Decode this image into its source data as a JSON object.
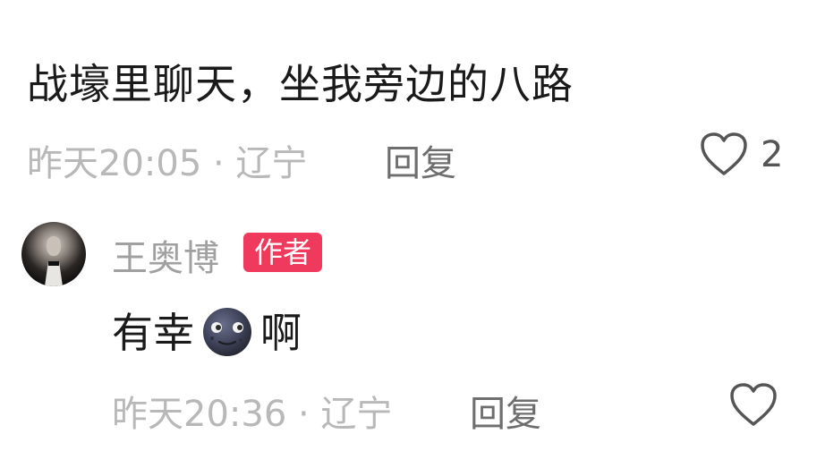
{
  "comment": {
    "text": "战壕里聊天，坐我旁边的八路",
    "meta": "昨天20:05 · 辽宁",
    "reply_label": "回复",
    "like_count": "2"
  },
  "reply": {
    "username": "王奥博",
    "badge": "作者",
    "text_before": "有幸",
    "text_after": "啊",
    "emoji": "new-moon-face-emoji",
    "meta": "昨天20:36 · 辽宁",
    "reply_label": "回复"
  },
  "colors": {
    "badge_bg": "#ef3a5d",
    "meta_text": "#b8b8b8",
    "body_text": "#1a1a1a"
  }
}
